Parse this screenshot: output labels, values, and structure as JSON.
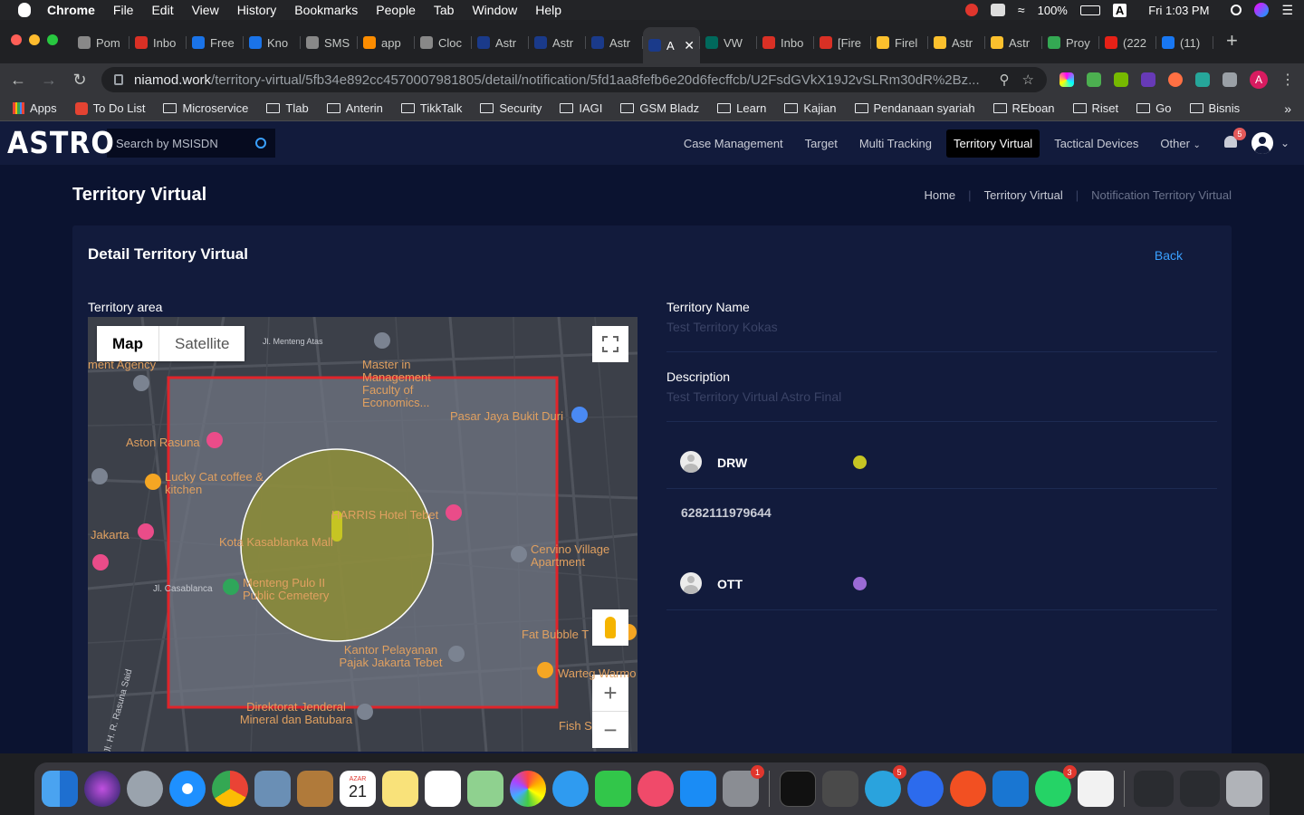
{
  "menubar": {
    "app": "Chrome",
    "items": [
      "File",
      "Edit",
      "View",
      "History",
      "Bookmarks",
      "People",
      "Tab",
      "Window",
      "Help"
    ],
    "battery": "100%",
    "clock": "Fri 1:03 PM",
    "input_letter": "A",
    "notif_badge": "5"
  },
  "tabs": [
    {
      "label": "Pom",
      "color": "#888888"
    },
    {
      "label": "Inbo",
      "color": "#d93025"
    },
    {
      "label": "Free",
      "color": "#1a73e8"
    },
    {
      "label": "Kno",
      "color": "#1a73e8"
    },
    {
      "label": "SMS",
      "color": "#888888"
    },
    {
      "label": "app",
      "color": "#fb8c00"
    },
    {
      "label": "Cloc",
      "color": "#888888"
    },
    {
      "label": "Astr",
      "color": "#1a3a8a"
    },
    {
      "label": "Astr",
      "color": "#1a3a8a"
    },
    {
      "label": "Astr",
      "color": "#1a3a8a"
    },
    {
      "label": "A",
      "color": "#1a3a8a",
      "active": true
    },
    {
      "label": "VW",
      "color": "#00695c"
    },
    {
      "label": "Inbo",
      "color": "#d93025"
    },
    {
      "label": "[Fire",
      "color": "#d93025"
    },
    {
      "label": "Firel",
      "color": "#fbc02d"
    },
    {
      "label": "Astr",
      "color": "#fbc02d"
    },
    {
      "label": "Astr",
      "color": "#fbc02d"
    },
    {
      "label": "Proy",
      "color": "#34a853"
    },
    {
      "label": "(222",
      "color": "#e62117"
    },
    {
      "label": "(11)",
      "color": "#1877f2"
    }
  ],
  "address": {
    "host": "niamod.work",
    "path": "/territory-virtual/5fb34e892cc4570007981805/detail/notification/5fd1aa8fefb6e20d6fecffcb/U2FsdGVkX19J2vSLRm30dR%2Bz..."
  },
  "bookmarks": [
    "Apps",
    "To Do List",
    "Microservice",
    "Tlab",
    "Anterin",
    "TikkTalk",
    "Security",
    "IAGI",
    "GSM Bladz",
    "Learn",
    "Kajian",
    "Pendanaan syariah",
    "REboan",
    "Riset",
    "Go",
    "Bisnis"
  ],
  "app": {
    "logo": "ASTRO",
    "search_placeholder": "Search by MSISDN",
    "nav": [
      "Case Management",
      "Target",
      "Multi Tracking",
      "Territory Virtual",
      "Tactical Devices",
      "Other"
    ],
    "notif_count": "5",
    "page_title": "Territory Virtual",
    "breadcrumb": [
      "Home",
      "Territory Virtual",
      "Notification Territory Virtual"
    ],
    "card_title": "Detail Territory Virtual",
    "back_label": "Back",
    "territory_area_label": "Territory area",
    "name_label": "Territory Name",
    "name_value": "Test Territory Kokas",
    "description_label": "Description",
    "description_value": "Test Territory Virtual Astro Final",
    "targets": [
      {
        "name": "DRW",
        "color": "#c6c523",
        "msisdn": "6282111979644"
      },
      {
        "name": "OTT",
        "color": "#9b6bd6"
      }
    ]
  },
  "map": {
    "mode_map": "Map",
    "mode_satellite": "Satellite",
    "labels": [
      "Jl. Menteng Atas",
      "Master in Management Faculty of Economics...",
      "Pasar Jaya Bukit Duri",
      "Aston Rasuna",
      "Lucky Cat coffee & kitchen",
      "Jakarta",
      "HARRIS Hotel Tebet",
      "Kota Kasablanka Mall",
      "Menteng Pulo II Public Cemetery",
      "Jl. Casablanca",
      "Cervino Village Apartment",
      "Kantor Pelayanan Pajak Jakarta Tebet",
      "Fat Bubble T",
      "Direktorat Jenderal Mineral dan Batubara",
      "Jl. H. R. Rasuna Said",
      "ment Agency",
      "Warteg Warmo",
      "Fish S"
    ]
  },
  "dock": {
    "calendar_month": "AZAR",
    "calendar_day": "21",
    "badges": [
      "1",
      "5",
      "3"
    ]
  }
}
